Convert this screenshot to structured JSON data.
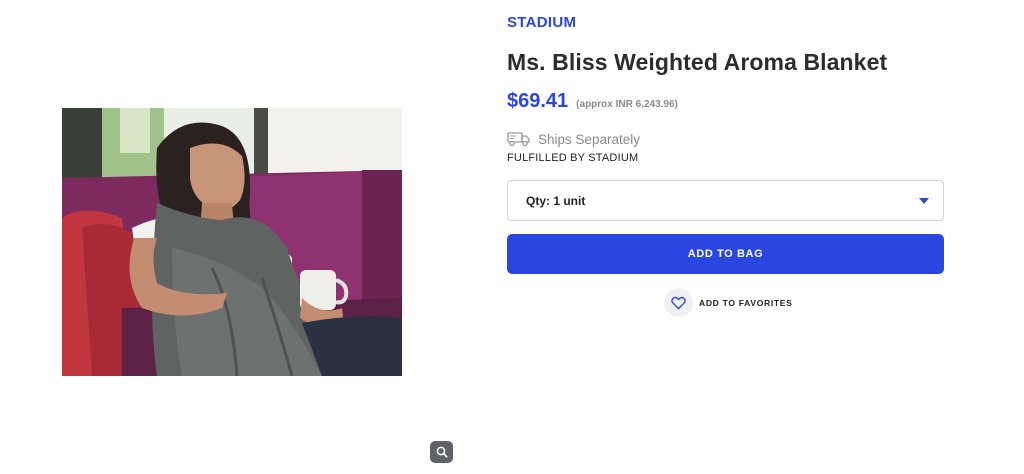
{
  "product": {
    "brand": "STADIUM",
    "title": "Ms. Bliss Weighted Aroma Blanket",
    "price": "$69.41",
    "price_approx": "(approx INR 6,243.96)",
    "image_alt": "Woman on a purple sofa wrapped in a grey weighted blanket holding a mug"
  },
  "shipping": {
    "icon": "truck-icon",
    "ships_text": "Ships Separately",
    "fulfilled_text": "FULFILLED BY STADIUM"
  },
  "quantity": {
    "selected": "Qty: 1 unit"
  },
  "actions": {
    "add_to_bag": "ADD TO BAG",
    "add_to_favorites": "ADD TO FAVORITES"
  },
  "colors": {
    "accent": "#2b46e0",
    "muted_text": "#8a8a8a"
  }
}
